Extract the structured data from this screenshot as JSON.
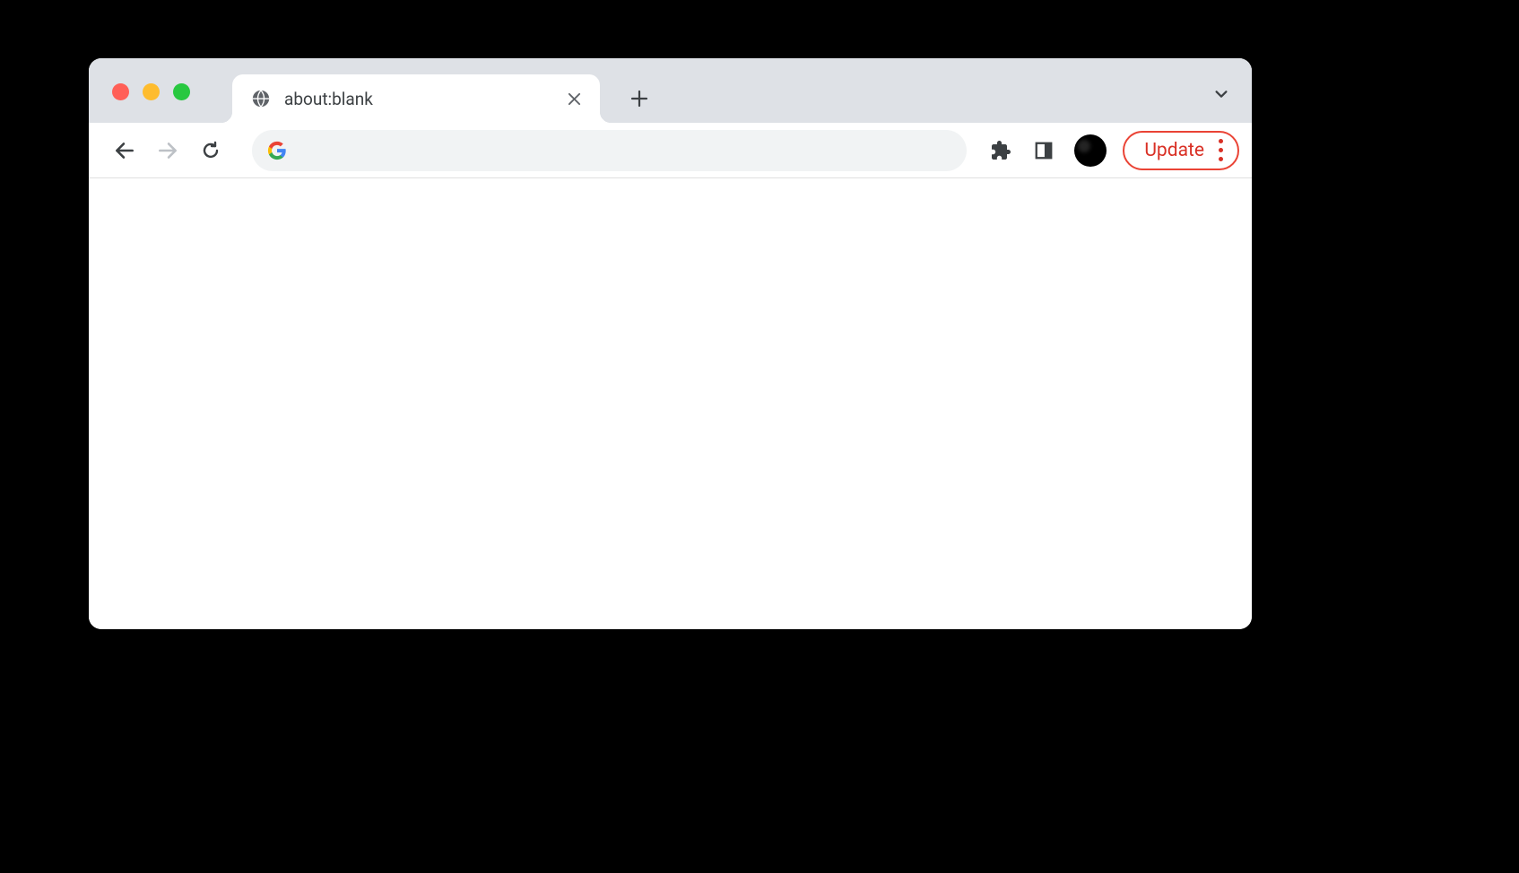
{
  "tab": {
    "title": "about:blank"
  },
  "omnibox": {
    "value": "",
    "placeholder": ""
  },
  "toolbar": {
    "update_label": "Update"
  },
  "colors": {
    "tab_strip_bg": "#dee1e6",
    "update_red": "#d93025",
    "traffic_close": "#ff5f57",
    "traffic_min": "#febc2e",
    "traffic_max": "#28c840"
  }
}
